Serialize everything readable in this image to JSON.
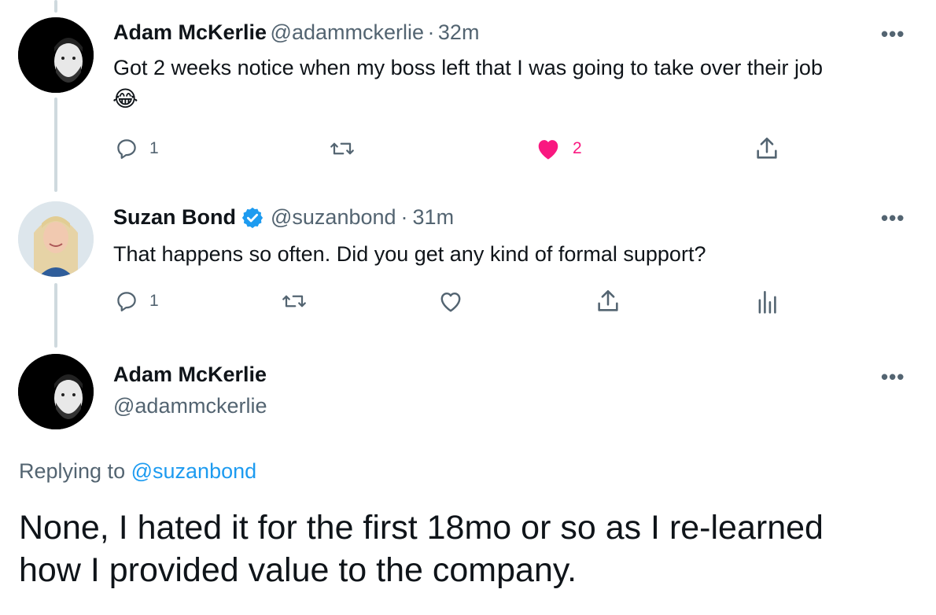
{
  "tweets": [
    {
      "name": "Adam McKerlie",
      "handle": "@adammckerlie",
      "sep": "·",
      "time": "32m",
      "text": "Got 2 weeks notice when my boss left that I was going to take over their job",
      "emoji": "😂",
      "actions": {
        "reply_count": "1",
        "like_count": "2",
        "liked": true
      }
    },
    {
      "name": "Suzan Bond",
      "verified": true,
      "handle": "@suzanbond",
      "sep": "·",
      "time": "31m",
      "text": "That happens so often. Did you get any kind of formal support?",
      "actions": {
        "reply_count": "1"
      }
    }
  ],
  "main_tweet": {
    "name": "Adam McKerlie",
    "handle": "@adammckerlie",
    "replying_prefix": "Replying to",
    "replying_to": "@suzanbond",
    "text_line1": "None, I hated it for the first 18mo or so as I re-learned",
    "text_line2": "how I provided value to the company."
  },
  "more_label": "•••",
  "colors": {
    "link": "#1d9bf0",
    "like": "#f91880",
    "muted": "#536471",
    "line": "#cfd9de"
  }
}
